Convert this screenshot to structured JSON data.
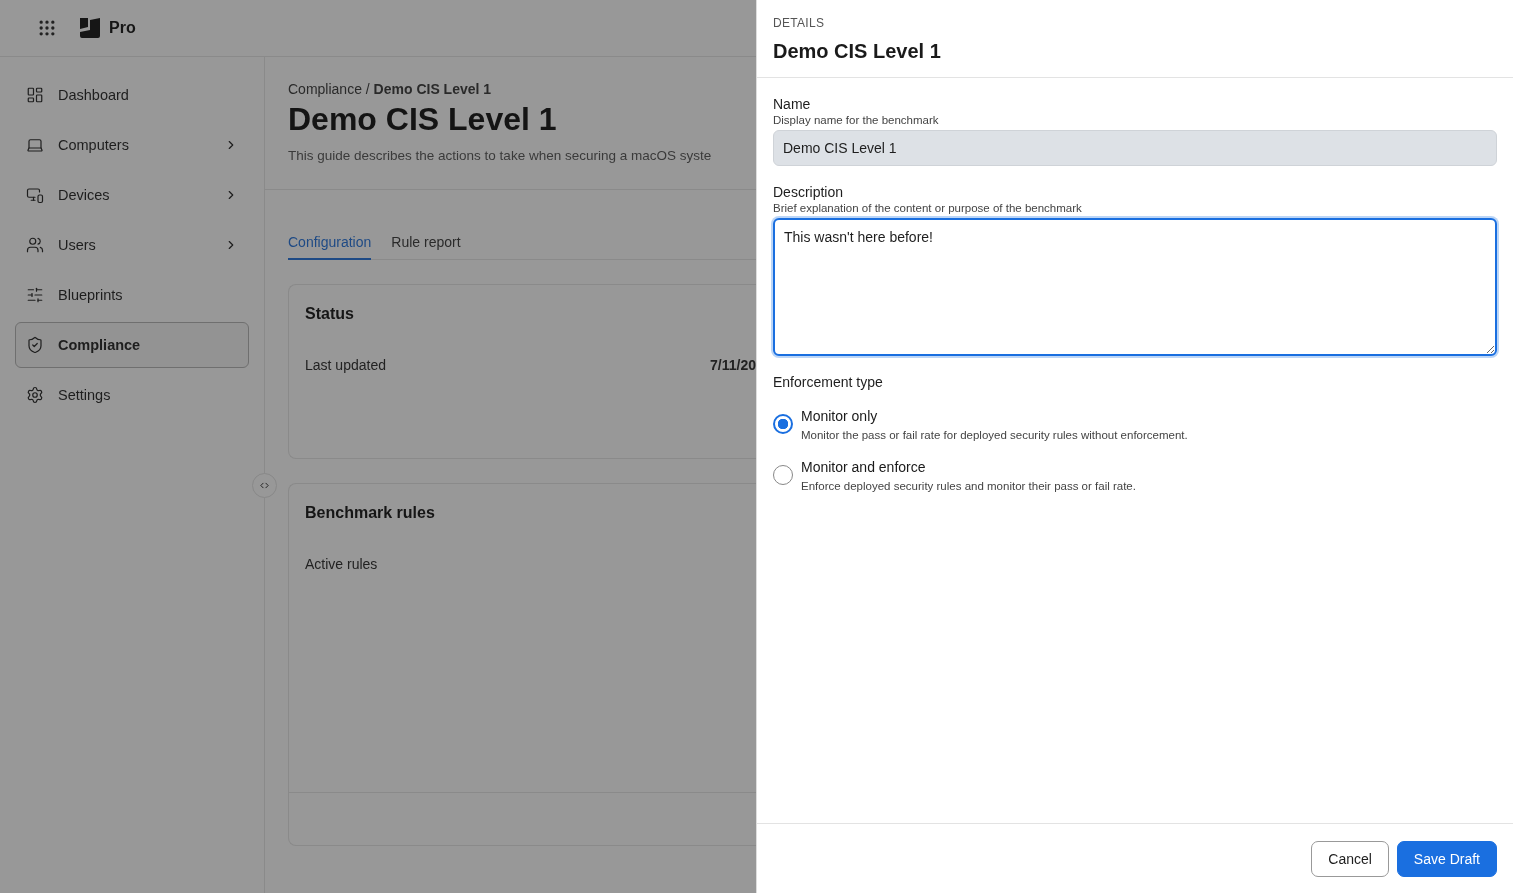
{
  "app": {
    "brand": "Pro"
  },
  "sidebar": {
    "items": [
      {
        "label": "Dashboard",
        "expandable": false,
        "selected": false
      },
      {
        "label": "Computers",
        "expandable": true,
        "selected": false
      },
      {
        "label": "Devices",
        "expandable": true,
        "selected": false
      },
      {
        "label": "Users",
        "expandable": true,
        "selected": false
      },
      {
        "label": "Blueprints",
        "expandable": false,
        "selected": false
      },
      {
        "label": "Compliance",
        "expandable": false,
        "selected": true
      },
      {
        "label": "Settings",
        "expandable": false,
        "selected": false
      }
    ]
  },
  "breadcrumb": {
    "parent": "Compliance",
    "separator": "/",
    "current": "Demo CIS Level 1"
  },
  "page": {
    "title": "Demo CIS Level 1",
    "description": "This guide describes the actions to take when securing a macOS syste"
  },
  "tabs": [
    {
      "label": "Configuration",
      "selected": true
    },
    {
      "label": "Rule report",
      "selected": false
    }
  ],
  "status_card": {
    "title": "Status",
    "rows": [
      {
        "label": "Last updated",
        "value": "7/11/20"
      }
    ]
  },
  "rules_card": {
    "title": "Benchmark rules",
    "rows": [
      {
        "label": "Active rules"
      }
    ]
  },
  "drawer": {
    "eyebrow": "DETAILS",
    "title": "Demo CIS Level 1",
    "fields": [
      {
        "kind": "input",
        "label": "Name",
        "hint": "Display name for the benchmark",
        "value": "Demo CIS Level 1",
        "disabled": true,
        "focused": false
      },
      {
        "kind": "textarea",
        "label": "Description",
        "hint": "Brief explanation of the content or purpose of the benchmark",
        "value": "This wasn't here before!",
        "disabled": false,
        "focused": true
      }
    ],
    "enforcement": {
      "label": "Enforcement type",
      "options": [
        {
          "label": "Monitor only",
          "description": "Monitor the pass or fail rate for deployed security rules without enforcement.",
          "selected": true
        },
        {
          "label": "Monitor and enforce",
          "description": "Enforce deployed security rules and monitor their pass or fail rate.",
          "selected": false
        }
      ]
    },
    "buttons": [
      {
        "label": "Cancel",
        "kind": "secondary"
      },
      {
        "label": "Save Draft",
        "kind": "primary"
      }
    ]
  }
}
